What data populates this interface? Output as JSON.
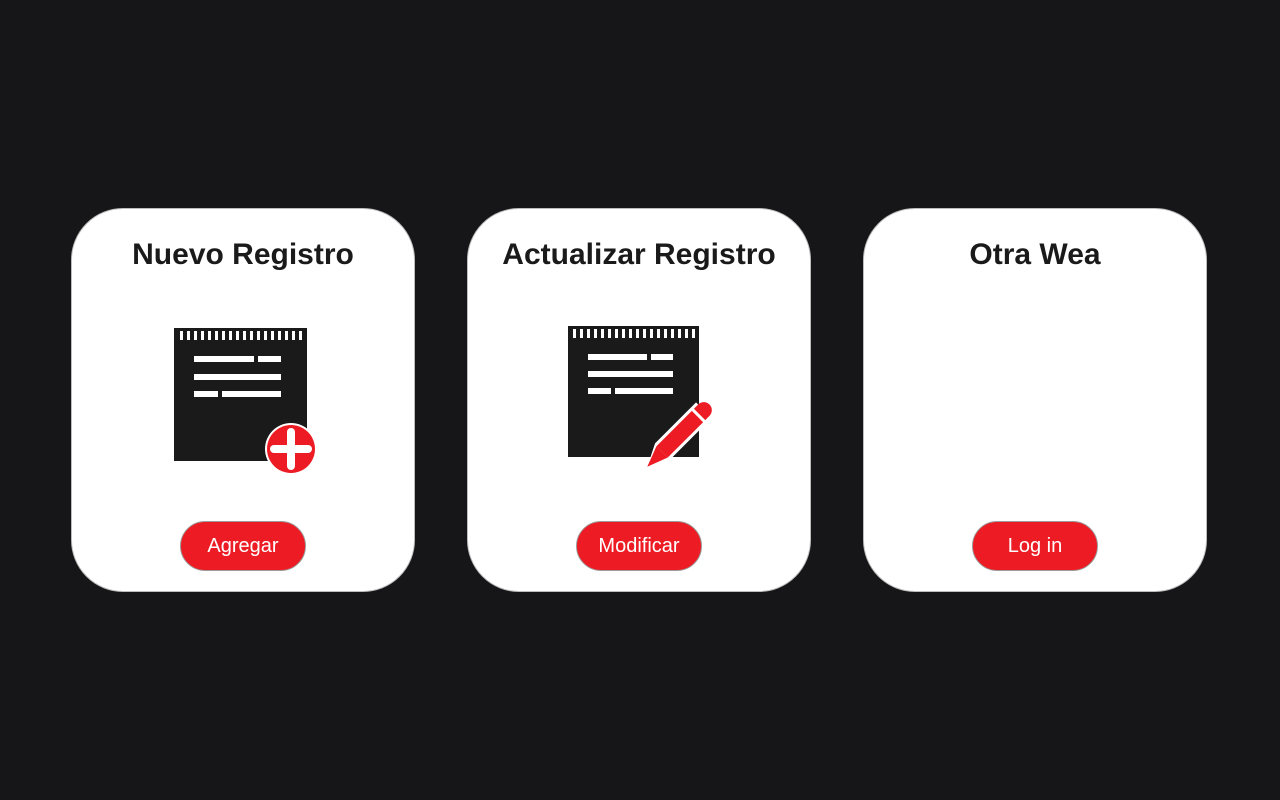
{
  "cards": [
    {
      "title": "Nuevo Registro",
      "icon": "document-add-icon",
      "button_label": "Agregar"
    },
    {
      "title": "Actualizar Registro",
      "icon": "document-edit-icon",
      "button_label": "Modificar"
    },
    {
      "title": "Otra Wea",
      "icon": "",
      "button_label": "Log in"
    }
  ],
  "colors": {
    "background": "#161618",
    "card": "#ffffff",
    "accent": "#ed1c24",
    "icon": "#1a1a1a"
  }
}
